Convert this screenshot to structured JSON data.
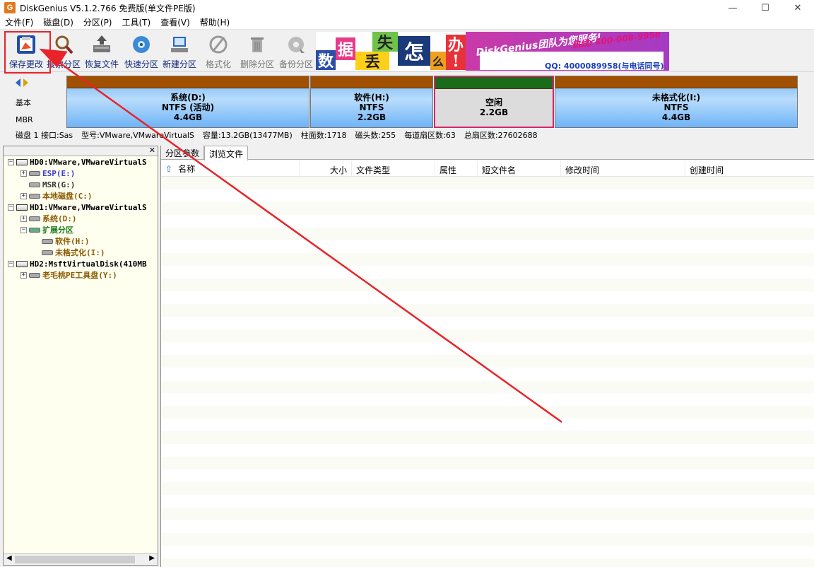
{
  "window": {
    "title": "DiskGenius V5.1.2.766 免费版(单文件PE版)",
    "icon_letter": "G",
    "minimize": "—",
    "maximize": "☐",
    "close": "✕"
  },
  "menu": [
    {
      "label": "文件(F)"
    },
    {
      "label": "磁盘(D)"
    },
    {
      "label": "分区(P)"
    },
    {
      "label": "工具(T)"
    },
    {
      "label": "查看(V)"
    },
    {
      "label": "帮助(H)"
    }
  ],
  "toolbar": [
    {
      "label": "保存更改",
      "icon": "save-disk-icon"
    },
    {
      "label": "搜索分区",
      "icon": "magnifier-icon"
    },
    {
      "label": "恢复文件",
      "icon": "restore-icon"
    },
    {
      "label": "快速分区",
      "icon": "quick-partition-icon"
    },
    {
      "label": "新建分区",
      "icon": "new-partition-icon"
    },
    {
      "label": "格式化",
      "icon": "format-icon"
    },
    {
      "label": "删除分区",
      "icon": "trash-icon"
    },
    {
      "label": "备份分区",
      "icon": "backup-icon"
    }
  ],
  "banner": {
    "tiles": [
      "数",
      "据",
      "丢",
      "失",
      "怎",
      "么",
      "办",
      "!"
    ],
    "slogan": "DiskGenius团队为您服务!",
    "phone": "热线: 400-008-9958",
    "qq": "QQ: 4000089958(与电话同号)"
  },
  "diskmap": {
    "type_label": "基本",
    "table_label": "MBR",
    "partitions": [
      {
        "name": "系统(D:)",
        "fs": "NTFS (活动)",
        "size": "4.4GB"
      },
      {
        "name": "软件(H:)",
        "fs": "NTFS",
        "size": "2.2GB"
      },
      {
        "name": "空闲",
        "fs": "",
        "size": "2.2GB"
      },
      {
        "name": "未格式化(I:)",
        "fs": "NTFS",
        "size": "4.4GB"
      }
    ],
    "info": [
      "磁盘 1 接口:Sas",
      "型号:VMware,VMwareVirtualS",
      "容量:13.2GB(13477MB)",
      "柱面数:1718",
      "磁头数:255",
      "每道扇区数:63",
      "总扇区数:27602688"
    ]
  },
  "tree": [
    {
      "label": "HD0:VMware,VMwareVirtualS",
      "kind": "disk",
      "indent": 0,
      "exp": "-",
      "color": "#000000"
    },
    {
      "label": "ESP(E:)",
      "kind": "part",
      "indent": 1,
      "exp": "+",
      "color": "#3b3bd0"
    },
    {
      "label": "MSR(G:)",
      "kind": "part",
      "indent": 1,
      "exp": "",
      "color": "#333333"
    },
    {
      "label": "本地磁盘(C:)",
      "kind": "part",
      "indent": 1,
      "exp": "+",
      "color": "#8a5a00"
    },
    {
      "label": "HD1:VMware,VMwareVirtualS",
      "kind": "disk",
      "indent": 0,
      "exp": "-",
      "color": "#000000"
    },
    {
      "label": "系统(D:)",
      "kind": "part",
      "indent": 1,
      "exp": "+",
      "color": "#8a5a00"
    },
    {
      "label": "扩展分区",
      "kind": "ext",
      "indent": 1,
      "exp": "-",
      "color": "#1a7a1a"
    },
    {
      "label": "软件(H:)",
      "kind": "part",
      "indent": 2,
      "exp": "",
      "color": "#8a5a00"
    },
    {
      "label": "未格式化(I:)",
      "kind": "part",
      "indent": 2,
      "exp": "",
      "color": "#8a5a00"
    },
    {
      "label": "HD2:MsftVirtualDisk(410MB",
      "kind": "disk",
      "indent": 0,
      "exp": "-",
      "color": "#000000"
    },
    {
      "label": "老毛桃PE工具盘(Y:)",
      "kind": "part",
      "indent": 1,
      "exp": "+",
      "color": "#8a5a00"
    }
  ],
  "tabs": [
    {
      "label": "分区参数",
      "active": false
    },
    {
      "label": "浏览文件",
      "active": true
    }
  ],
  "columns": [
    "名称",
    "大小",
    "文件类型",
    "属性",
    "短文件名",
    "修改时间",
    "创建时间"
  ],
  "colors": {
    "accent_red": "#e8232a",
    "partition_top_brown": "#a05000",
    "free_partition_border": "#d8246c"
  }
}
